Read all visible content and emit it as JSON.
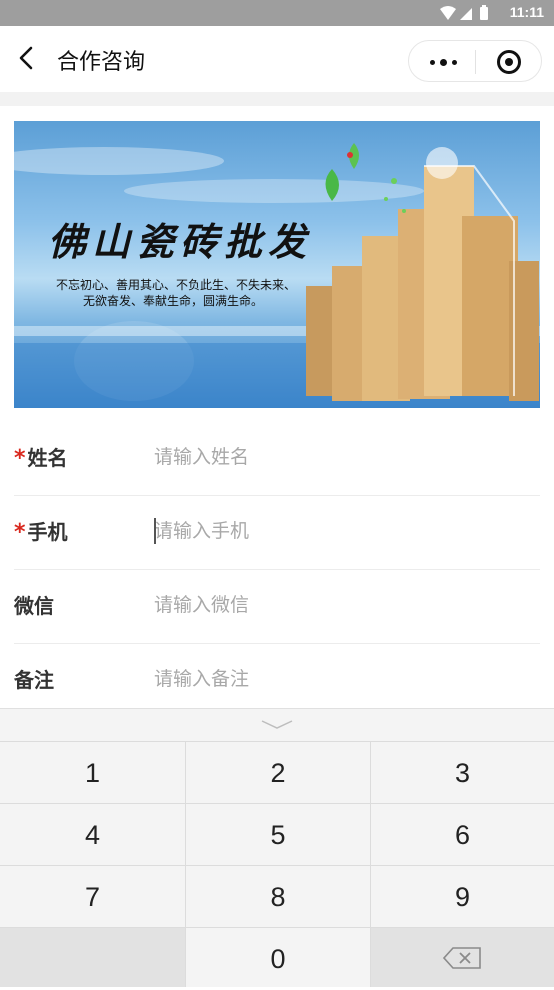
{
  "status_bar": {
    "time": "11:11",
    "icons": [
      "wifi-icon",
      "signal-icon",
      "battery-icon"
    ]
  },
  "nav": {
    "title": "合作咨询",
    "more_icon": "more-dots-icon",
    "close_icon": "miniprogram-close-icon",
    "back_icon": "chevron-left-icon"
  },
  "banner": {
    "title": "佛山瓷砖批发",
    "slogan_line1": "不忘初心、善用其心、不负此生、不失未来、",
    "slogan_line2": "无欲奋发、奉献生命，圆满生命。"
  },
  "form": {
    "name": {
      "label": "姓名",
      "required": true,
      "placeholder": "请输入姓名",
      "value": ""
    },
    "phone": {
      "label": "手机",
      "required": true,
      "placeholder": "请输入手机",
      "value": ""
    },
    "wechat": {
      "label": "微信",
      "required": false,
      "placeholder": "请输入微信",
      "value": ""
    },
    "note": {
      "label": "备注",
      "required": false,
      "placeholder": "请输入备注",
      "value": ""
    },
    "required_mark": "*"
  },
  "keyboard": {
    "collapse_icon": "chevron-down-icon",
    "keys": [
      "1",
      "2",
      "3",
      "4",
      "5",
      "6",
      "7",
      "8",
      "9",
      "0"
    ],
    "delete_icon": "backspace-icon"
  },
  "colors": {
    "required": "#d9281e",
    "status_bar": "#9e9e9e",
    "placeholder": "#a8a8a8"
  }
}
